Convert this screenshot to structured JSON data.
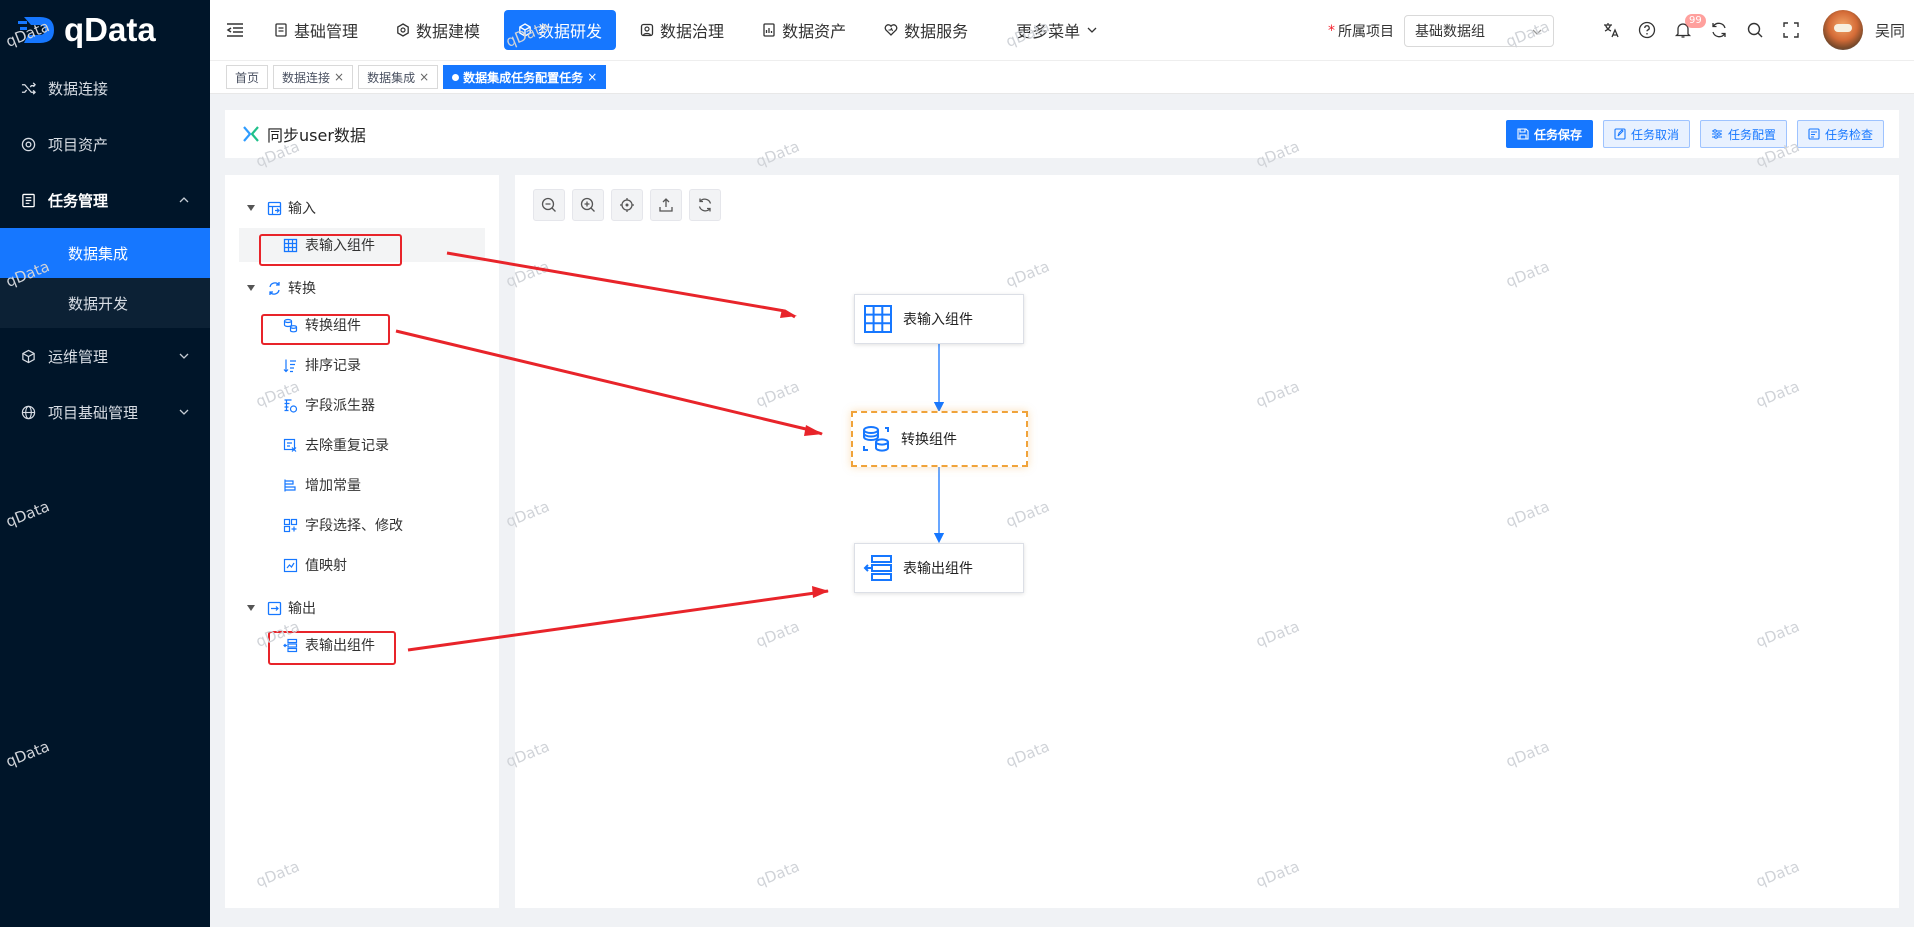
{
  "brand": {
    "name": "qData"
  },
  "sidebar": {
    "items": [
      {
        "label": "数据连接",
        "icon": "shuffle-icon"
      },
      {
        "label": "项目资产",
        "icon": "asset-icon"
      },
      {
        "label": "任务管理",
        "icon": "task-list-icon",
        "expanded": true,
        "children": [
          {
            "label": "数据集成",
            "active": true
          },
          {
            "label": "数据开发",
            "active": false
          }
        ]
      },
      {
        "label": "运维管理",
        "icon": "cube-icon"
      },
      {
        "label": "项目基础管理",
        "icon": "globe-icon"
      }
    ]
  },
  "topnav": {
    "items": [
      {
        "label": "基础管理",
        "icon": "doc-icon"
      },
      {
        "label": "数据建模",
        "icon": "hexagon-icon"
      },
      {
        "label": "数据研发",
        "icon": "box-icon",
        "active": true
      },
      {
        "label": "数据治理",
        "icon": "governance-icon"
      },
      {
        "label": "数据资产",
        "icon": "asset-file-icon"
      },
      {
        "label": "数据服务",
        "icon": "heart-icon"
      },
      {
        "label": "更多菜单",
        "icon": "chevron-down-icon"
      }
    ],
    "project_label": "所属项目",
    "project_value": "基础数据组",
    "notification_count": "99",
    "username": "吴同"
  },
  "tabs": [
    {
      "label": "首页",
      "closable": false,
      "active": false
    },
    {
      "label": "数据连接",
      "closable": true,
      "active": false
    },
    {
      "label": "数据集成",
      "closable": true,
      "active": false
    },
    {
      "label": "数据集成任务配置任务",
      "closable": true,
      "active": true
    }
  ],
  "task": {
    "title": "同步user数据",
    "actions": [
      {
        "label": "任务保存",
        "primary": true,
        "icon": "save-icon"
      },
      {
        "label": "任务取消",
        "primary": false,
        "icon": "edit-icon"
      },
      {
        "label": "任务配置",
        "primary": false,
        "icon": "sliders-icon"
      },
      {
        "label": "任务检查",
        "primary": false,
        "icon": "check-doc-icon"
      }
    ]
  },
  "tree": {
    "groups": [
      {
        "label": "输入",
        "items": [
          "表输入组件"
        ]
      },
      {
        "label": "转换",
        "items": [
          "转换组件",
          "排序记录",
          "字段派生器",
          "去除重复记录",
          "增加常量",
          "字段选择、修改",
          "值映射"
        ]
      },
      {
        "label": "输出",
        "items": [
          "表输出组件"
        ]
      }
    ]
  },
  "canvas": {
    "nodes": [
      {
        "label": "表输入组件",
        "icon": "table-grid-icon"
      },
      {
        "label": "转换组件",
        "icon": "database-transform-icon",
        "selected": true
      },
      {
        "label": "表输出组件",
        "icon": "table-output-icon"
      }
    ],
    "toolbar": [
      "zoom-out-icon",
      "zoom-in-icon",
      "locate-icon",
      "export-icon",
      "refresh-icon"
    ]
  },
  "watermark": "qData",
  "colors": {
    "primary": "#1677ff",
    "sidebar_bg": "#001529",
    "annotation_red": "#e8242a",
    "selected_border": "#f0a33a"
  }
}
